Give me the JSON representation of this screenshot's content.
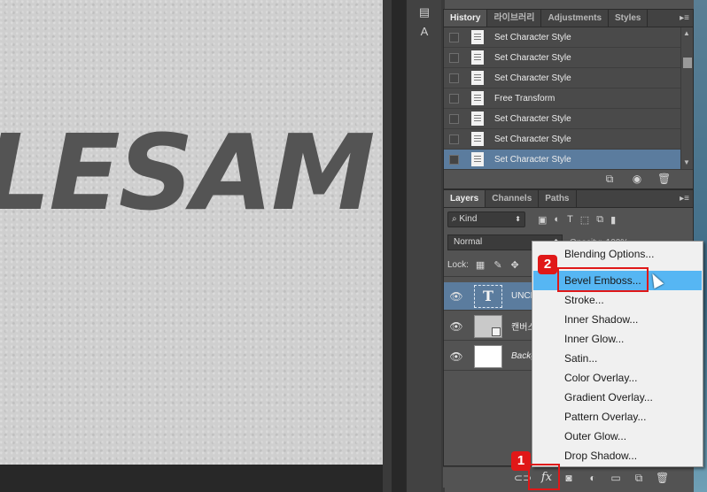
{
  "canvas": {
    "text": "LESAM"
  },
  "history_panel": {
    "tabs": [
      "History",
      "라이브러리",
      "Adjustments",
      "Styles"
    ],
    "menu_icon": "panel-menu-icon",
    "items": [
      "Set Character Style",
      "Set Character Style",
      "Set Character Style",
      "Free Transform",
      "Set Character Style",
      "Set Character Style",
      "Set Character Style"
    ],
    "selected_index": 6
  },
  "layers_panel": {
    "tabs": [
      "Layers",
      "Channels",
      "Paths"
    ],
    "filter_kind": "Kind",
    "blend_mode": "Normal",
    "opacity_label": "Opacity:",
    "opacity_value": "100%",
    "lock_label": "Lock:",
    "layers": [
      {
        "name": "UNCL",
        "type": "text",
        "thumb_glyph": "T"
      },
      {
        "name": "캔버스",
        "type": "smart"
      },
      {
        "name": "Backg",
        "type": "background"
      }
    ]
  },
  "context_menu": {
    "items": [
      "Blending Options...",
      "Bevel  Emboss...",
      "Stroke...",
      "Inner Shadow...",
      "Inner Glow...",
      "Satin...",
      "Color Overlay...",
      "Gradient Overlay...",
      "Pattern Overlay...",
      "Outer Glow...",
      "Drop Shadow..."
    ],
    "hovered_index": 1
  },
  "annotations": {
    "badge_1": "1",
    "badge_2": "2"
  },
  "fx_label": "fx",
  "colors": {
    "selection": "#5b7c9e",
    "menu_hover": "#56b6f3",
    "annotation_red": "#e01818"
  }
}
